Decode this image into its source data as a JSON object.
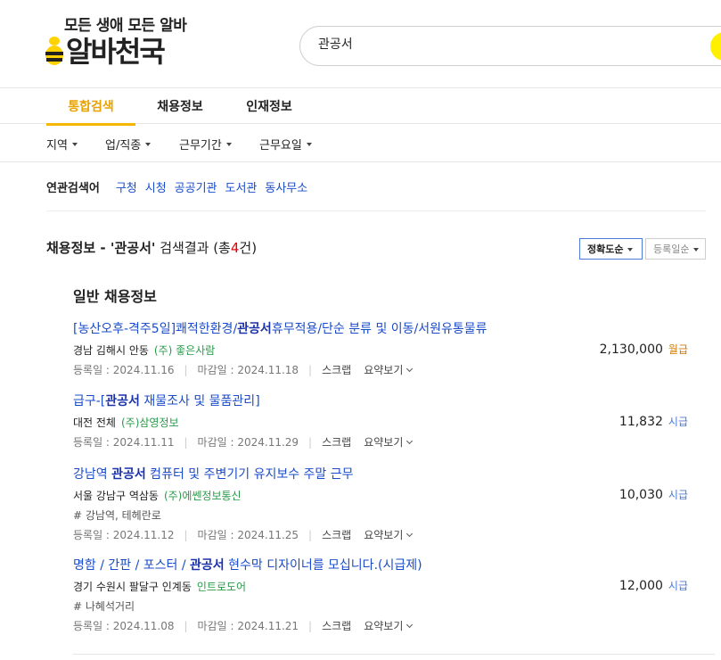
{
  "header": {
    "slogan": "모든 생애 모든 알바",
    "logo_text": "알바천국",
    "search_value": "관공서"
  },
  "tabs": [
    {
      "label": "통합검색",
      "active": true
    },
    {
      "label": "채용정보",
      "active": false
    },
    {
      "label": "인재정보",
      "active": false
    }
  ],
  "filters": [
    "지역",
    "업/직종",
    "근무기간",
    "근무요일"
  ],
  "related": {
    "label": "연관검색어",
    "links": [
      "구청",
      "시청",
      "공공기관",
      "도서관",
      "동사무소"
    ]
  },
  "result": {
    "prefix": "채용정보 - '관공서'",
    "mid": " 검색결과 (총",
    "count": "4",
    "suffix": "건)",
    "sort_active": "정확도순",
    "sort_inactive": "등록일순"
  },
  "section_title": "일반 채용정보",
  "jobs": [
    {
      "title_a": "[농산오후-격주5일]쾌적한환경/",
      "title_b": "관공서",
      "title_c": "휴무적용/단순 분류 및 이동/서원유통물류",
      "location": "경남 김해시 안동",
      "company": "(주) 좋은사람",
      "tag": "",
      "reg": "등록일 : 2024.11.16",
      "deadline": "마감일 : 2024.11.18",
      "scrap": "스크랩",
      "summary": "요약보기",
      "pay": "2,130,000",
      "pay_unit": "월급"
    },
    {
      "title_a": "급구-[",
      "title_b": "관공서",
      "title_c": " 재물조사 및 물품관리]",
      "location": "대전 전체",
      "company": "(주)삼영정보",
      "tag": "",
      "reg": "등록일 : 2024.11.11",
      "deadline": "마감일 : 2024.11.29",
      "scrap": "스크랩",
      "summary": "요약보기",
      "pay": "11,832",
      "pay_unit": "시급"
    },
    {
      "title_a": "강남역 ",
      "title_b": "관공서",
      "title_c": " 컴퓨터 및 주변기기 유지보수 주말 근무",
      "location": "서울 강남구 역삼동",
      "company": "(주)에쎈정보통신",
      "tag": "# 강남역, 테헤란로",
      "reg": "등록일 : 2024.11.12",
      "deadline": "마감일 : 2024.11.25",
      "scrap": "스크랩",
      "summary": "요약보기",
      "pay": "10,030",
      "pay_unit": "시급"
    },
    {
      "title_a": "명함 / 간판 / 포스터 / ",
      "title_b": "관공서",
      "title_c": " 현수막 디자이너를 모십니다.(시급제)",
      "location": "경기 수원시 팔달구 인계동",
      "company": "인트로도어",
      "tag": "# 나혜석거리",
      "reg": "등록일 : 2024.11.08",
      "deadline": "마감일 : 2024.11.21",
      "scrap": "스크랩",
      "summary": "요약보기",
      "pay": "12,000",
      "pay_unit": "시급"
    }
  ],
  "colors": {
    "brand_yellow": "#fff000",
    "active_tab": "#e8a300",
    "link_blue": "#1a4bc9",
    "company_green": "#2a9a4a",
    "count_red": "#e8000b"
  }
}
